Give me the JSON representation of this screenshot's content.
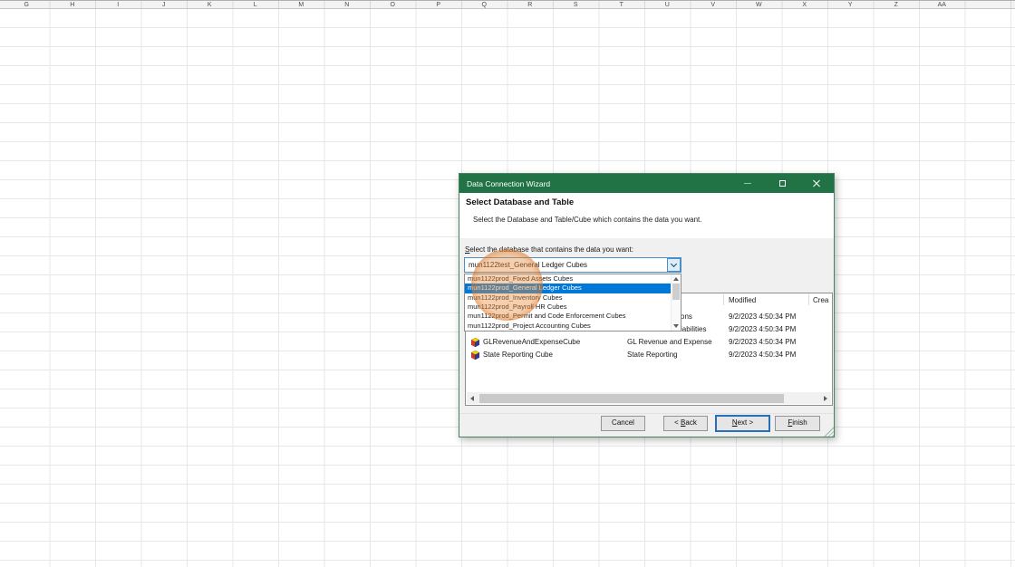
{
  "spreadsheet": {
    "column_headers": [
      "G",
      "H",
      "I",
      "J",
      "K",
      "L",
      "M",
      "N",
      "O",
      "P",
      "Q",
      "R",
      "S",
      "T",
      "U",
      "V",
      "W",
      "X",
      "Y",
      "Z",
      "AA"
    ]
  },
  "dialog": {
    "title": "Data Connection Wizard",
    "heading": "Select Database and Table",
    "subheading": "Select the Database and Table/Cube which contains the data you want.",
    "database_label": {
      "label": "Select the database that contains the data you want:",
      "accel_index": 0
    },
    "combo_value": "mun1122test_General Ledger Cubes",
    "dropdown": {
      "items": [
        "mun1122prod_Fixed Assets Cubes",
        "mun1122prod_General Ledger Cubes",
        "mun1122prod_Inventory Cubes",
        "mun1122prod_Payroll HR Cubes",
        "mun1122prod_Permit and Code Enforcement Cubes",
        "mun1122prod_Project Accounting Cubes"
      ],
      "selected_index": 1
    },
    "table": {
      "visible_headers": [
        "Modified",
        "Crea"
      ],
      "occluded_rows": [
        {
          "description_fragment": "ons",
          "modified": "9/2/2023 4:50:34 PM"
        },
        {
          "description_fragment": "iabilities",
          "modified": "9/2/2023 4:50:34 PM"
        }
      ],
      "rows": [
        {
          "name": "GLRevenueAndExpenseCube",
          "description": "GL Revenue and Expense",
          "modified": "9/2/2023 4:50:34 PM"
        },
        {
          "name": "State Reporting Cube",
          "description": "State Reporting",
          "modified": "9/2/2023 4:50:34 PM"
        }
      ]
    },
    "buttons": {
      "cancel": {
        "label": "Cancel",
        "accel_index": -1
      },
      "back": {
        "label": "< Back",
        "accel_index": 2
      },
      "next": {
        "label": "Next >",
        "accel_index": 0
      },
      "finish": {
        "label": "Finish",
        "accel_index": 0
      }
    }
  },
  "colors": {
    "titlebar_green": "#217346",
    "selection_blue": "#0078d7",
    "highlight_circle_orange": "#df7726"
  }
}
